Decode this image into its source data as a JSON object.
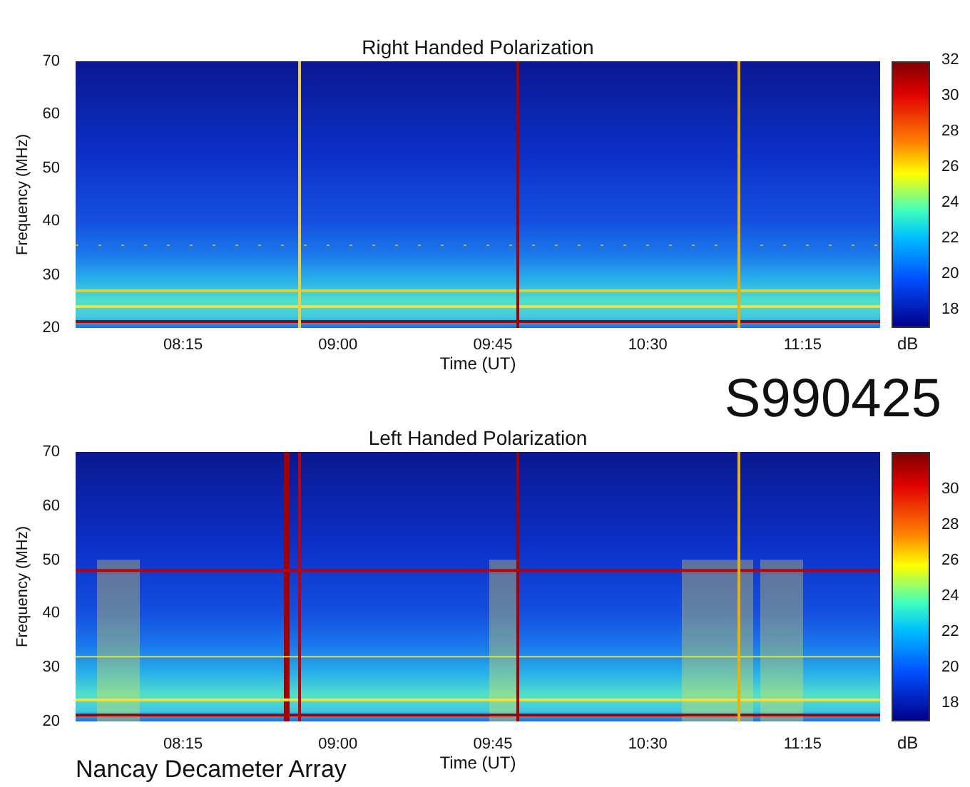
{
  "panels": [
    {
      "title": "Right Handed Polarization",
      "ylabel": "Frequency (MHz)",
      "yticks": [
        "70",
        "60",
        "50",
        "40",
        "30",
        "20"
      ],
      "xticks": [
        "08:15",
        "09:00",
        "09:45",
        "10:30",
        "11:15"
      ],
      "xlabel": "Time (UT)",
      "colorbar": {
        "ticks": [
          "32",
          "30",
          "28",
          "26",
          "24",
          "22",
          "20",
          "18"
        ],
        "unit": "dB"
      }
    },
    {
      "title": "Left Handed Polarization",
      "ylabel": "Frequency (MHz)",
      "yticks": [
        "70",
        "60",
        "50",
        "40",
        "30",
        "20"
      ],
      "xticks": [
        "08:15",
        "09:00",
        "09:45",
        "10:30",
        "11:15"
      ],
      "xlabel": "Time (UT)",
      "colorbar": {
        "ticks": [
          "30",
          "28",
          "26",
          "24",
          "22",
          "20",
          "18"
        ],
        "unit": "dB"
      }
    }
  ],
  "event_id": "S990425",
  "footer": "Nancay Decameter Array"
}
